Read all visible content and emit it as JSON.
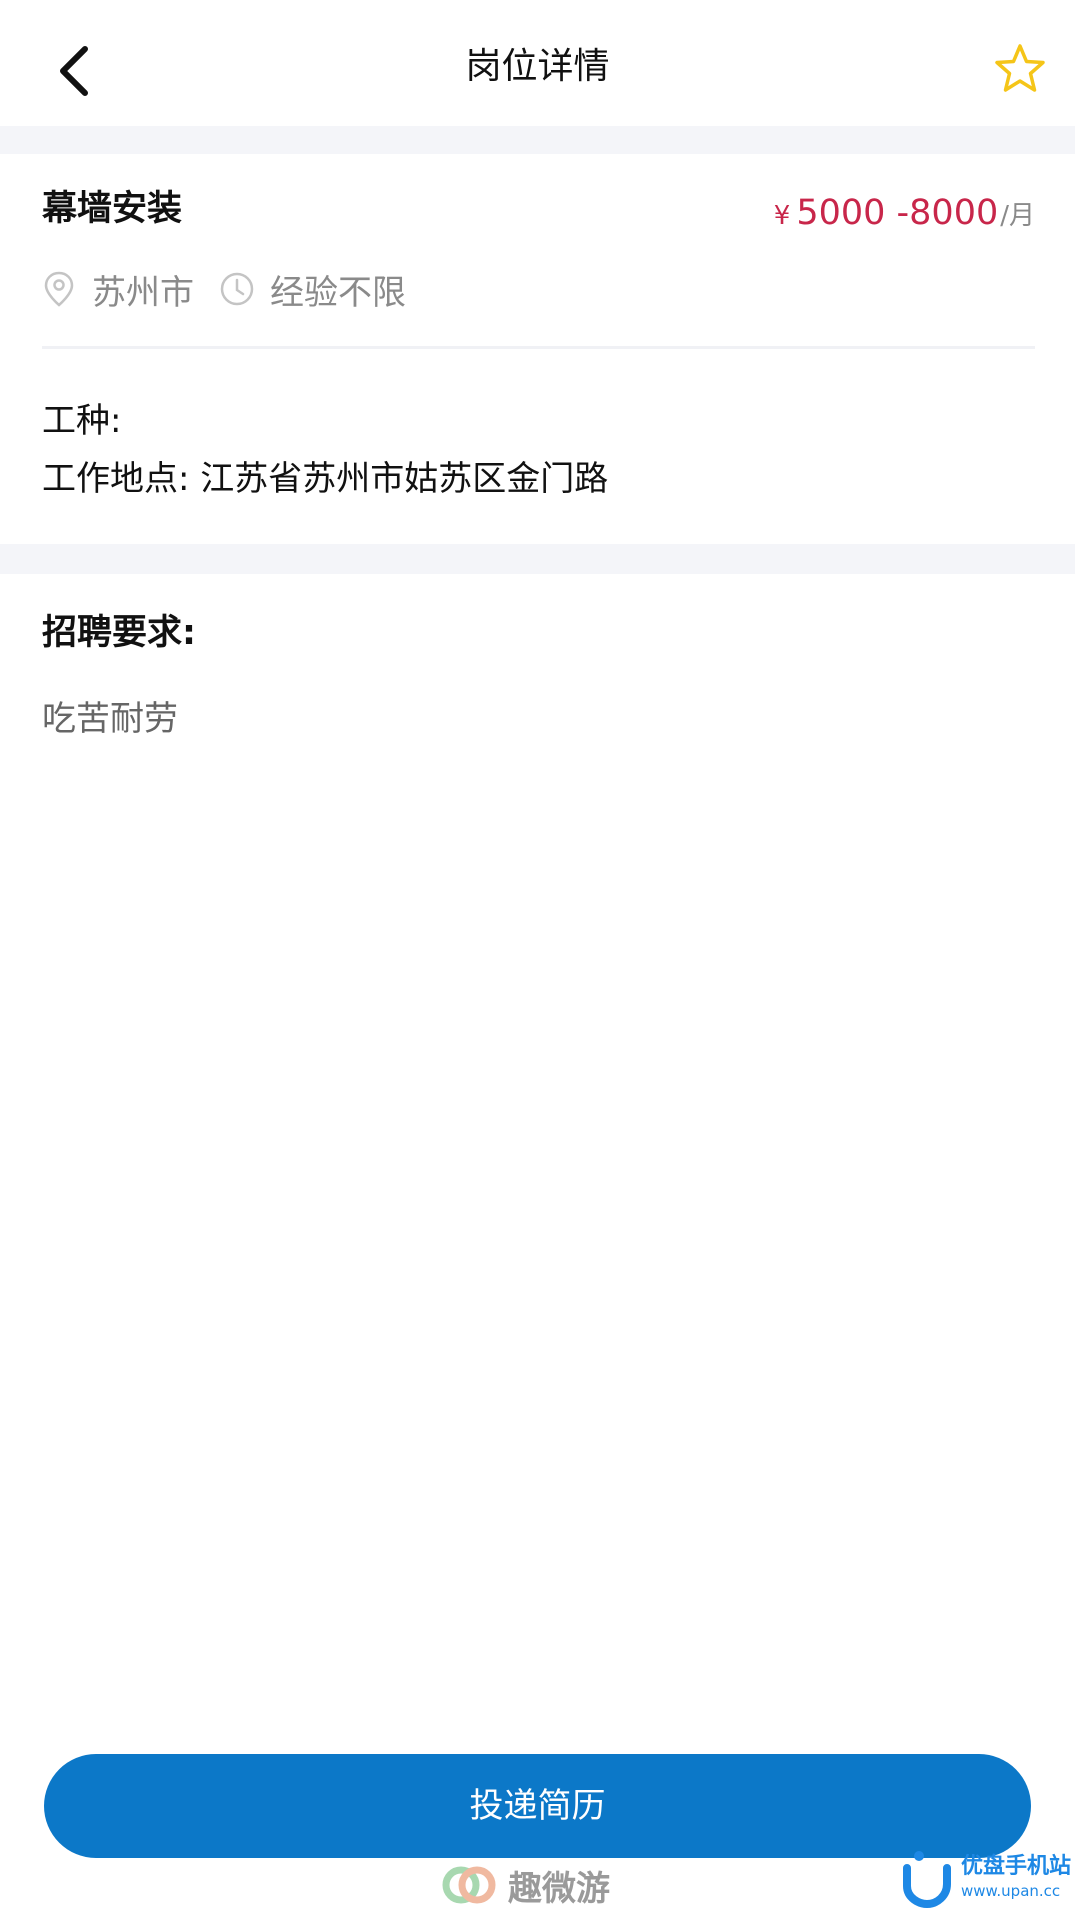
{
  "header": {
    "title": "岗位详情",
    "back_icon": "chevron-left-icon",
    "favorite_icon": "star-outline-icon",
    "favorite_color": "#f5c518"
  },
  "job": {
    "title": "幕墙安装",
    "salary": {
      "currency": "¥",
      "range": "5000 -8000",
      "unit": "/月",
      "color": "#c8264a"
    },
    "city": "苏州市",
    "experience": "经验不限",
    "trade_label": "工种:",
    "location_label": "工作地点:",
    "location_value": "江苏省苏州市姑苏区金门路"
  },
  "requirements": {
    "heading": "招聘要求:",
    "text": "吃苦耐劳"
  },
  "actions": {
    "submit_label": "投递简历",
    "submit_color": "#0c78c8"
  },
  "watermarks": {
    "left_text": "趣微游",
    "right_name": "优盘手机站",
    "right_url": "www.upan.cc"
  }
}
